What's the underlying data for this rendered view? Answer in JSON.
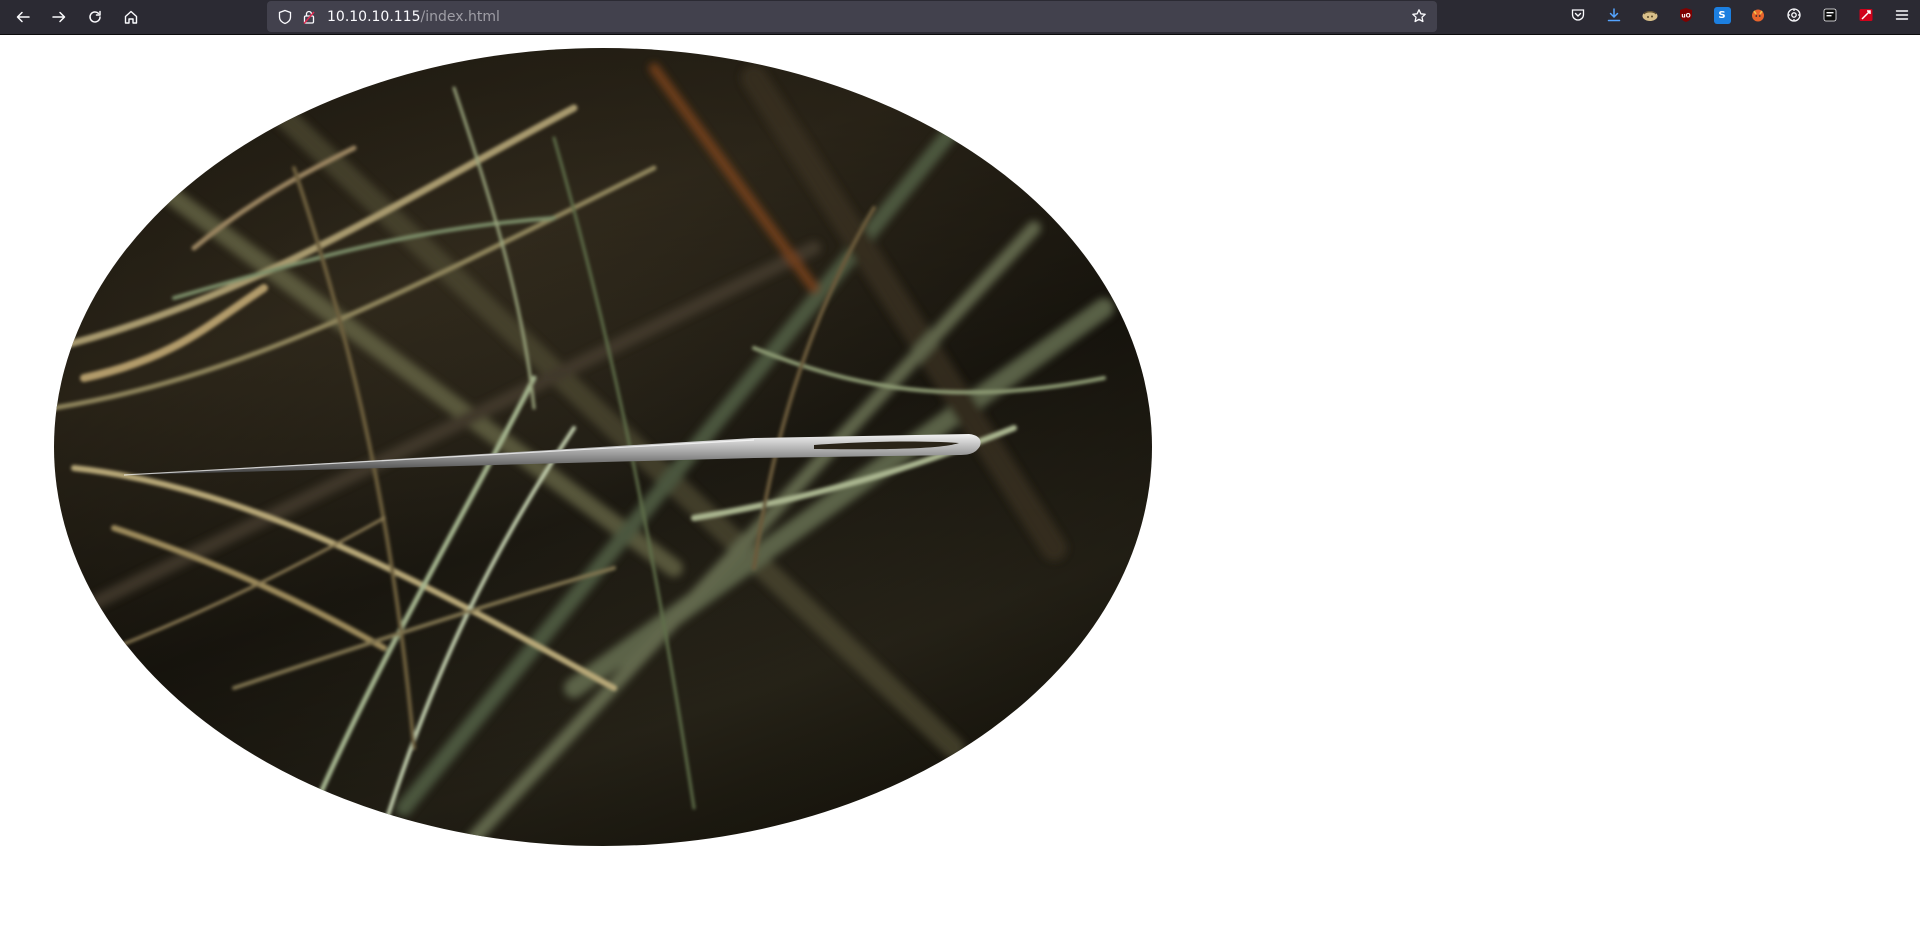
{
  "browser": {
    "url_host": "10.10.10.115",
    "url_path": "/index.html",
    "nav_icons": [
      "back-icon",
      "forward-icon",
      "reload-icon",
      "home-icon"
    ],
    "url_icons": [
      "shield-icon",
      "lock-icon"
    ],
    "bookmark_icon": "star-icon",
    "extensions": [
      {
        "name": "pocket-icon",
        "color": "#fbfbfe"
      },
      {
        "name": "downloads-icon",
        "color": "#54a4ff"
      },
      {
        "name": "cookie-extension-icon",
        "color": "#d9c08a"
      },
      {
        "name": "ublock-origin-icon",
        "color": "#800000"
      },
      {
        "name": "s-extension-icon",
        "color": "#1c7fe0"
      },
      {
        "name": "foxy-extension-icon",
        "color": "#e8642c"
      },
      {
        "name": "gear-extension-icon",
        "color": "#fbfbfe"
      },
      {
        "name": "dark-extension-icon",
        "color": "#0f0f0f"
      },
      {
        "name": "red-extension-icon",
        "color": "#d0021b"
      },
      {
        "name": "menu-icon",
        "color": "#fbfbfe"
      }
    ]
  },
  "page": {
    "image_subject": "needle in a haystack",
    "image_shape": "ellipse"
  }
}
